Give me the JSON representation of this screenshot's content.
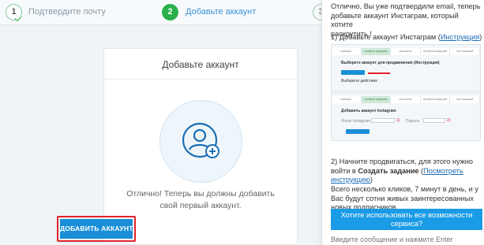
{
  "stepper": {
    "steps": [
      {
        "number": "1",
        "label": "Подтвердите почту",
        "state": "done"
      },
      {
        "number": "2",
        "label": "Добавьте аккаунт",
        "state": "active"
      },
      {
        "number": "3",
        "label": "",
        "state": "pending"
      }
    ]
  },
  "card": {
    "title": "Добавьте аккаунт",
    "message_line1": "Отлично! Теперь вы должны добавить",
    "message_line2": "свой первый аккаунт.",
    "button_label": "ДОБАВИТЬ АККАУНТ"
  },
  "chat": {
    "intro_line1": "Отлично, Вы уже подтвердили email, теперь",
    "intro_line2": "добавьте аккаунт Инстаграм, который хотите",
    "intro_line3": "раскрутить !",
    "step1_prefix": "1) Добавьте аккаунт Инстаграм (",
    "step1_link": "Инструкция",
    "step1_suffix": ")",
    "step2_line1": "2) Начните продвигаться, для этого нужно",
    "step2_prefix": "войти в ",
    "step2_bold": "Создать задание",
    "step2_link": "Посмотреть инструкцию",
    "step3_line1": "Всего несколько кликов, 7 минут в день, и у",
    "step3_line2": "Вас будут сотни живых заинтересованных",
    "step3_line3": "новых подписчиков.",
    "cta_line1": "Хотите использовать все возможности",
    "cta_line2": "сервиса?",
    "input_placeholder": "Введите сообщение и нажмите Enter"
  },
  "tutorial": {
    "tabs1": [
      "КАБИНЕТ",
      "СОЗДАТЬ ЗАДАНИЕ",
      "АККАУНТЫ",
      "ИСТОРИЯ ЗАДАНИЙ",
      "ТОП ЗАДАНИЙ"
    ],
    "tabs2": [
      "КАБИНЕТ",
      "СОЗДАТЬ ЗАДАНИЕ",
      "АККАУНТЫ",
      "ИСТОРИЯ ЗАДАНИЙ",
      "ТОП ЗАДАНИЙ"
    ],
    "shot1_heading": "Выберете аккаунт для продвижения (Инструкция)",
    "shot1_sub": "Выберите действие",
    "shot1_button": "Добавить аккаунт",
    "shot2_heading": "Добавить аккаунт Instagram",
    "shot2_field1": "Логин Instagram",
    "shot2_field2": "Пароль",
    "shot2_num1": "1)",
    "shot2_num2": "2)",
    "shot2_button": "Добавить аккаунт"
  },
  "colors": {
    "accent_blue": "#1a8fd8",
    "step_green": "#2ab04a",
    "highlight_red": "#e0242a"
  }
}
